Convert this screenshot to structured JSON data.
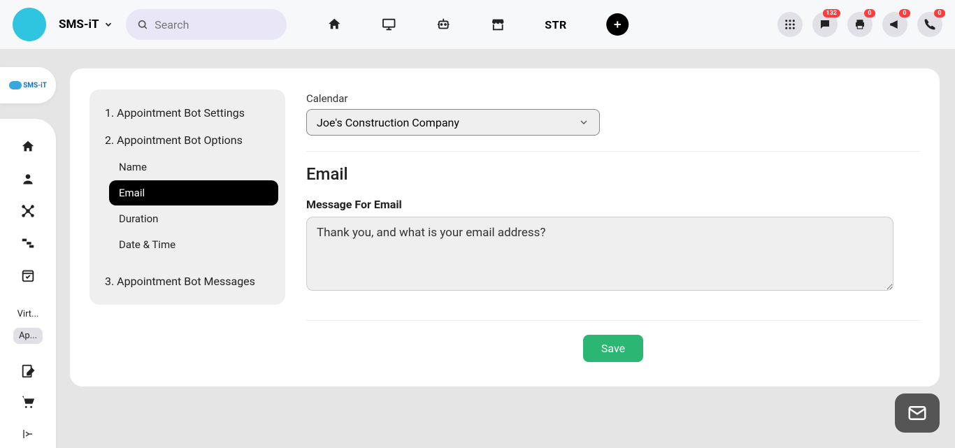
{
  "header": {
    "brand": "SMS-iT",
    "search_placeholder": "Search",
    "center": {
      "str_label": "STR"
    },
    "badges": {
      "chat": "132",
      "print": "0",
      "announce": "0",
      "phone": "0"
    }
  },
  "sidebar": {
    "logo_text": "SMS-iT",
    "text_items": [
      {
        "label": "Virt...",
        "active": false
      },
      {
        "label": "Ap...",
        "active": true
      }
    ]
  },
  "settings_nav": {
    "item1": "1. Appointment Bot Settings",
    "item2": "2. Appointment Bot Options",
    "subs": [
      {
        "label": "Name",
        "active": false
      },
      {
        "label": "Email",
        "active": true
      },
      {
        "label": "Duration",
        "active": false
      },
      {
        "label": "Date & Time",
        "active": false
      }
    ],
    "item3": "3. Appointment Bot Messages"
  },
  "content": {
    "calendar_label": "Calendar",
    "calendar_value": "Joe's Construction Company",
    "section_title": "Email",
    "message_label": "Message For Email",
    "message_value": "Thank you, and what is your email address?",
    "save_label": "Save"
  }
}
